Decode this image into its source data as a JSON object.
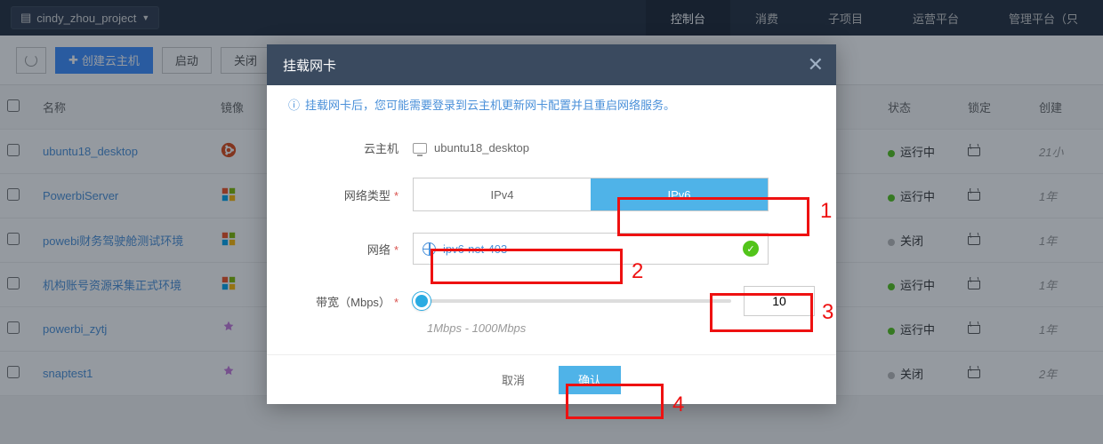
{
  "header": {
    "project_name": "cindy_zhou_project",
    "nav": {
      "console": "控制台",
      "consume": "消费",
      "subproject": "子项目",
      "ops_platform": "运营平台",
      "mgmt_platform": "管理平台（只"
    }
  },
  "toolbar": {
    "create_vm": "创建云主机",
    "start": "启动",
    "close": "关闭"
  },
  "table": {
    "headers": {
      "name": "名称",
      "image": "镜像",
      "status": "状态",
      "locked": "锁定",
      "created": "创建"
    },
    "rows": [
      {
        "name": "ubuntu18_desktop",
        "os": "ubuntu",
        "status_color": "green",
        "status": "运行中",
        "created": "21小"
      },
      {
        "name": "PowerbiServer",
        "os": "windows",
        "status_color": "green",
        "status": "运行中",
        "created": "1年"
      },
      {
        "name": "powebi财务驾驶舱测试环境",
        "os": "windows",
        "status_color": "gray",
        "status": "关闭",
        "created": "1年"
      },
      {
        "name": "机构账号资源采集正式环境",
        "os": "windows",
        "status_color": "green",
        "status": "运行中",
        "created": "1年"
      },
      {
        "name": "powerbi_zytj",
        "os": "other",
        "status_color": "green",
        "status": "运行中",
        "created": "1年"
      },
      {
        "name": "snaptest1",
        "os": "other",
        "status_color": "gray",
        "status": "关闭",
        "created": "2年"
      }
    ]
  },
  "modal": {
    "title": "挂载网卡",
    "info": "挂载网卡后，您可能需要登录到云主机更新网卡配置并且重启网络服务。",
    "labels": {
      "host": "云主机",
      "net_type": "网络类型",
      "network": "网络",
      "bandwidth": "带宽（Mbps）"
    },
    "host_value": "ubuntu18_desktop",
    "ipv4": "IPv4",
    "ipv6": "IPv6",
    "network_value": "ipv6-net-403",
    "bandwidth_value": "10",
    "bandwidth_hint": "1Mbps - 1000Mbps",
    "cancel": "取消",
    "confirm": "确认"
  },
  "annotations": {
    "n1": "1",
    "n2": "2",
    "n3": "3",
    "n4": "4"
  }
}
